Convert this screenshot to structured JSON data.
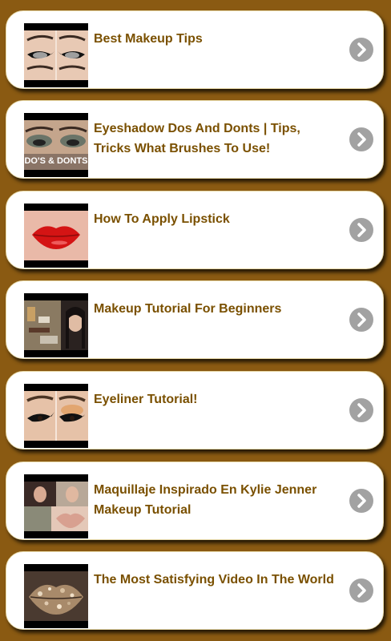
{
  "items": [
    {
      "title": "Best Makeup Tips",
      "thumb_icon": "eyeliner-eyes-image",
      "chevron_icon": "chevron-right-icon"
    },
    {
      "title": "Eyeshadow Dos And Donts | Tips, Tricks What Brushes To Use!",
      "thumb_icon": "eyeshadow-eyes-image",
      "thumb_caption": "DO'S & DONTS",
      "chevron_icon": "chevron-right-icon"
    },
    {
      "title": "How To Apply Lipstick",
      "thumb_icon": "red-lips-image",
      "chevron_icon": "chevron-right-icon"
    },
    {
      "title": "Makeup Tutorial For Beginners",
      "thumb_icon": "makeup-products-image",
      "chevron_icon": "chevron-right-icon"
    },
    {
      "title": "Eyeliner Tutorial!",
      "thumb_icon": "winged-eyeliner-image",
      "chevron_icon": "chevron-right-icon"
    },
    {
      "title": "Maquillaje Inspirado En Kylie Jenner Makeup Tutorial",
      "thumb_icon": "kylie-lips-collage-image",
      "chevron_icon": "chevron-right-icon"
    },
    {
      "title": "The Most Satisfying Video In The World",
      "thumb_icon": "glitter-lips-image",
      "chevron_icon": "chevron-right-icon"
    }
  ],
  "colors": {
    "background": "#8a5a12",
    "card": "#ffffff",
    "title": "#7a5000",
    "chevron_bg": "#a2a2a2"
  }
}
